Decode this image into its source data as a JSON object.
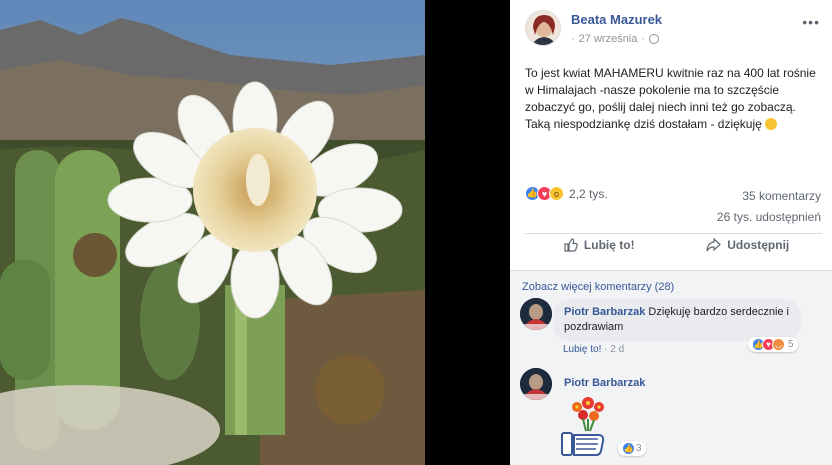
{
  "post": {
    "author": "Beata Mazurek",
    "date": "27 września",
    "privacy_icon": "globe-icon",
    "text": "To jest kwiat MAHAMERU kwitnie raz na 400 lat rośnie w Himalajach -nasze pokolenie ma to szczęście zobaczyć go, poślij dalej niech inni też go zobaczą. Taką niespodziankę dziś dostałam - dziękuję",
    "text_emoji": "smiling-face-icon"
  },
  "stats": {
    "reaction_count": "2,2 tys.",
    "comments": "35 komentarzy",
    "shares": "26 tys. udostępnień",
    "reaction_icons": [
      "like-icon",
      "love-icon",
      "wow-icon"
    ]
  },
  "actions": {
    "like": "Lubię to!",
    "share": "Udostępnij"
  },
  "comments": {
    "see_more": "Zobacz więcej komentarzy (28)",
    "items": [
      {
        "author": "Piotr Barbarzak",
        "text": "Dziękuję bardzo serdecznie i pozdrawiam",
        "like_label": "Lubię to!",
        "separator": " · ",
        "time": "2 d",
        "reactions": "5"
      },
      {
        "author": "Piotr Barbarzak",
        "sticker": "like-with-flowers-sticker",
        "reactions": "3"
      }
    ]
  },
  "colors": {
    "link": "#385898",
    "like": "#3b82f0",
    "love": "#f33e58",
    "wow": "#f7c331"
  }
}
